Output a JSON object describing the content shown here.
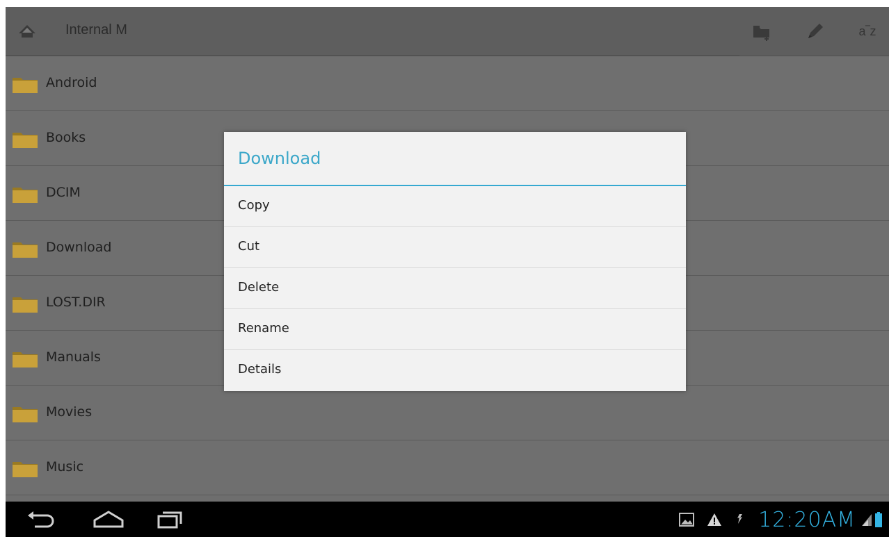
{
  "action_bar": {
    "path_label": "Internal M",
    "home_icon": "home-icon",
    "new_folder_icon": "new-folder-icon",
    "edit_icon": "pencil-icon",
    "sort_label": "a‾z"
  },
  "file_list": [
    {
      "label": "Android"
    },
    {
      "label": "Books"
    },
    {
      "label": "DCIM"
    },
    {
      "label": "Download"
    },
    {
      "label": "LOST.DIR"
    },
    {
      "label": "Manuals"
    },
    {
      "label": "Movies"
    },
    {
      "label": "Music"
    }
  ],
  "dialog": {
    "title": "Download",
    "items": [
      {
        "label": "Copy"
      },
      {
        "label": "Cut"
      },
      {
        "label": "Delete"
      },
      {
        "label": "Rename"
      },
      {
        "label": "Details"
      }
    ]
  },
  "status_bar": {
    "time": "12:20AM",
    "icons": [
      "gallery-notification-icon",
      "warning-icon",
      "usb-debug-icon",
      "signal-icon",
      "battery-icon"
    ]
  },
  "colors": {
    "accent": "#36a9d1",
    "clock": "#34b5e5",
    "folder": "#c9a13a"
  }
}
